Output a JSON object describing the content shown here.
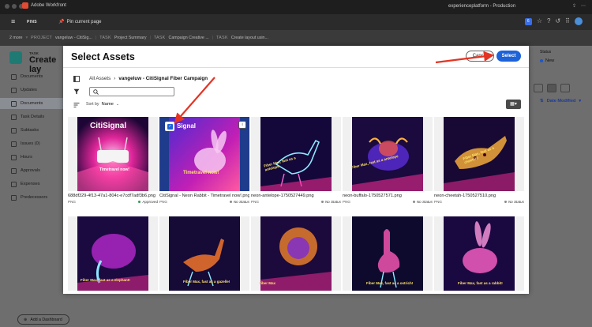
{
  "titlebar": {
    "app_name": "Adobe Workfront",
    "center_text": "experienceplatform - Production"
  },
  "appbar": {
    "pins": "PINS",
    "pin_current": "Pin current page",
    "badge_count": "6"
  },
  "breadcrumbs": {
    "more": "2 more",
    "items": [
      {
        "label": "PROJECT",
        "value": "vangeluw - CitiSig..."
      },
      {
        "label": "TASK",
        "value": "Project Summary"
      },
      {
        "label": "TASK",
        "value": "Campaign Creative ..."
      },
      {
        "label": "TASK",
        "value": "Create layout usin..."
      }
    ]
  },
  "page": {
    "task_label": "TASK",
    "task_title": "Create lay",
    "sidebar": [
      "Documents",
      "Updates",
      "Documents",
      "Task Details",
      "Subtasks",
      "Issues (0)",
      "Hours",
      "Approvals",
      "Expenses",
      "Predecessors"
    ],
    "add_dashboard": "Add a Dashboard",
    "status_label": "Status",
    "status_value": "New",
    "sort_label": "Date Modified"
  },
  "modal": {
    "title": "Select Assets",
    "cancel": "Cancel",
    "select": "Select",
    "breadcrumb_root": "All Assets",
    "breadcrumb_folder": "vangeluw - CitiSignal Fiber Campaign",
    "search_placeholder": "",
    "sort_by_label": "Sort by",
    "sort_by_value": "Name",
    "assets": [
      {
        "name": "688df329-4f13-47a1-804c-e7cdf7adf3b6.png",
        "type": "PNG",
        "status": "Approved",
        "text1": "CitiSignal",
        "text2": "Timetravel now!"
      },
      {
        "name": "CitiSignal - Neon Rabbit - Timetravel now!.png",
        "type": "PNG",
        "status": "No Status",
        "text1": "Signal",
        "text2": "Timetravel now!"
      },
      {
        "name": "neon-antelope-1750527449.png",
        "type": "PNG",
        "status": "No Status",
        "text1": "Fiber Max, fast as a antelope",
        "text2": ""
      },
      {
        "name": "neon-buffalo-1750527571.png",
        "type": "PNG",
        "status": "No Status",
        "text1": "Fiber Max, fast as a antelope",
        "text2": ""
      },
      {
        "name": "neon-cheetah-1750527510.png",
        "type": "PNG",
        "status": "No Status",
        "text1": "Fiber Max, fast as a cheetah!",
        "text2": ""
      },
      {
        "name": "",
        "type": "",
        "status": "",
        "text1": "Fiber Max, fast as a elephant!",
        "text2": ""
      },
      {
        "name": "",
        "type": "",
        "status": "",
        "text1": "Fiber Max, fast as a gazelle!",
        "text2": ""
      },
      {
        "name": "",
        "type": "",
        "status": "",
        "text1": "Fiber Max",
        "text2": ""
      },
      {
        "name": "",
        "type": "",
        "status": "",
        "text1": "Fiber Max, fast as a ostrich!",
        "text2": ""
      },
      {
        "name": "",
        "type": "",
        "status": "",
        "text1": "Fiber Max, fast as a rabbit!",
        "text2": ""
      }
    ]
  },
  "colors": {
    "accent": "#1d62d8",
    "annotation_arrow": "#e53323",
    "approved": "#2a9d4a"
  }
}
